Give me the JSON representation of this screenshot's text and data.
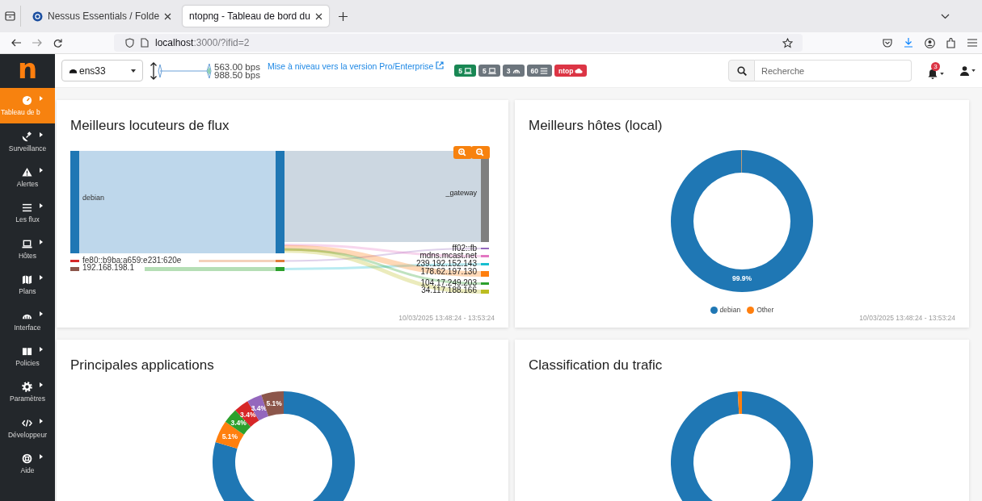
{
  "browser": {
    "tabs": [
      {
        "title": "Nessus Essentials / Folde",
        "selected": false
      },
      {
        "title": "ntopng - Tableau de bord du",
        "selected": true
      }
    ],
    "url": {
      "host": "localhost",
      "path": ":3000/?ifid=2"
    }
  },
  "sidebar": {
    "logo": "n",
    "items": [
      {
        "label": "Tableau de b",
        "selected": true
      },
      {
        "label": "Surveillance",
        "selected": false
      },
      {
        "label": "Alertes",
        "selected": false
      },
      {
        "label": "Les flux",
        "selected": false
      },
      {
        "label": "Hôtes",
        "selected": false
      },
      {
        "label": "Plans",
        "selected": false
      },
      {
        "label": "Interface",
        "selected": false
      },
      {
        "label": "Policies",
        "selected": false
      },
      {
        "label": "Paramètres",
        "selected": false
      },
      {
        "label": "Développeur",
        "selected": false
      },
      {
        "label": "Aide",
        "selected": false
      }
    ]
  },
  "topbar": {
    "interface": "ens33",
    "upload": "563.00 bps",
    "download": "988.50 bps",
    "upgrade_link": "Mise à niveau vers la version Pro/Enterprise",
    "badges": [
      {
        "text": "5",
        "color": "#198754"
      },
      {
        "text": "5",
        "color": "#6c757d"
      },
      {
        "text": "3",
        "color": "#6c757d"
      },
      {
        "text": "60",
        "color": "#6c757d"
      },
      {
        "text": "ntop",
        "color": "#dc3545"
      }
    ],
    "search": {
      "placeholder": "Recherche"
    },
    "notifications": "3"
  },
  "cards": [
    {
      "kind": "sankey",
      "title": "Meilleurs locuteurs de flux",
      "sankey": {
        "sources": [
          {
            "name": "debian",
            "color": "#1f77b4"
          },
          {
            "name": "fe80::b9ba:a659:e231:620e",
            "color": "#d62728"
          },
          {
            "name": "192.168.198.1",
            "color": "#8c564b"
          }
        ],
        "middle": [
          {
            "color": "#1f77b4"
          },
          {
            "color": "#e07b39"
          },
          {
            "color": "#2ca02c"
          }
        ],
        "targets": [
          {
            "name": "_gateway",
            "color": "#7f7f7f"
          },
          {
            "name": "ff02::fb",
            "color": "#9467bd"
          },
          {
            "name": "mdns.mcast.net",
            "color": "#e377c2"
          },
          {
            "name": "239.192.152.143",
            "color": "#17becf"
          },
          {
            "name": "178.62.197.130",
            "color": "#ff7f0e"
          },
          {
            "name": "104.17.249.203",
            "color": "#2ca02c"
          },
          {
            "name": "34.117.188.166",
            "color": "#bcbd22"
          }
        ]
      },
      "time_range": "10/03/2025 13:48:24 - 13:53:24"
    },
    {
      "kind": "chart",
      "title": "Meilleurs hôtes (local)",
      "chart_data": {
        "type": "donut",
        "categories": [
          "debian",
          "Other"
        ],
        "values": [
          99.9,
          0.1
        ],
        "value_labels": [
          "99.9%",
          null
        ]
      },
      "time_range": "10/03/2025 13:48:24 - 13:53:24"
    },
    {
      "kind": "chart",
      "title": "Principales applications",
      "chart_data": {
        "type": "donut",
        "values": [
          79.6,
          5.1,
          3.4,
          3.4,
          3.4,
          5.1
        ],
        "value_labels": [
          null,
          "5.1%",
          "3.4%",
          "3.4%",
          "3.4%",
          "5.1%"
        ]
      }
    },
    {
      "kind": "donut_picture",
      "title": "Classification du trafic"
    }
  ]
}
